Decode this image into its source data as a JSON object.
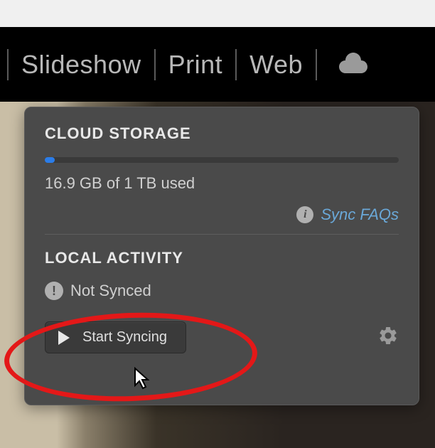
{
  "tabs": {
    "slideshow": "Slideshow",
    "print": "Print",
    "web": "Web"
  },
  "panel": {
    "cloud_storage_title": "CLOUD STORAGE",
    "storage_text": "16.9 GB of 1 TB used",
    "faq_link": "Sync FAQs",
    "local_activity_title": "LOCAL ACTIVITY",
    "sync_status": "Not Synced",
    "start_button": "Start Syncing",
    "progress_percent": 1.69
  }
}
